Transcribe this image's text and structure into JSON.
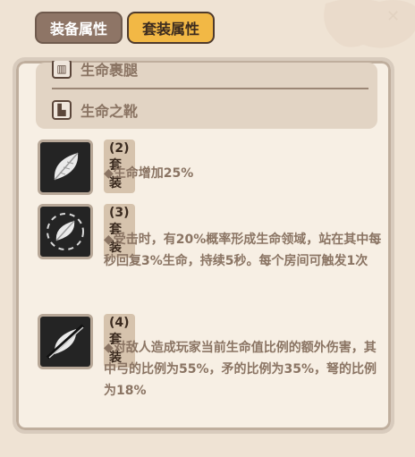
{
  "tabs": [
    {
      "label": "装备属性"
    },
    {
      "label": "套装属性"
    }
  ],
  "equipment": [
    {
      "label": "生命裹腿",
      "icon": "legs-icon"
    },
    {
      "label": "生命之靴",
      "icon": "boots-icon"
    }
  ],
  "sets": [
    {
      "label": "(2)套装",
      "desc": "◆生命增加25%",
      "icon": "leaf-icon"
    },
    {
      "label": "(3)套装",
      "desc": "◆受击时，有20%概率形成生命领域，站在其中每秒回复3%生命，持续5秒。每个房间可触发1次",
      "icon": "leaf-ring-icon"
    },
    {
      "label": "(4)套装",
      "desc": "◆对敌人造成玩家当前生命值比例的额外伤害，其中弓的比例为55%，矛的比例为35%，弩的比例为18%",
      "icon": "leaf-slash-icon"
    }
  ],
  "colors": {
    "tab_active": "#f2b845",
    "tab_inactive": "#8e7566",
    "panel": "#f7efe4"
  }
}
